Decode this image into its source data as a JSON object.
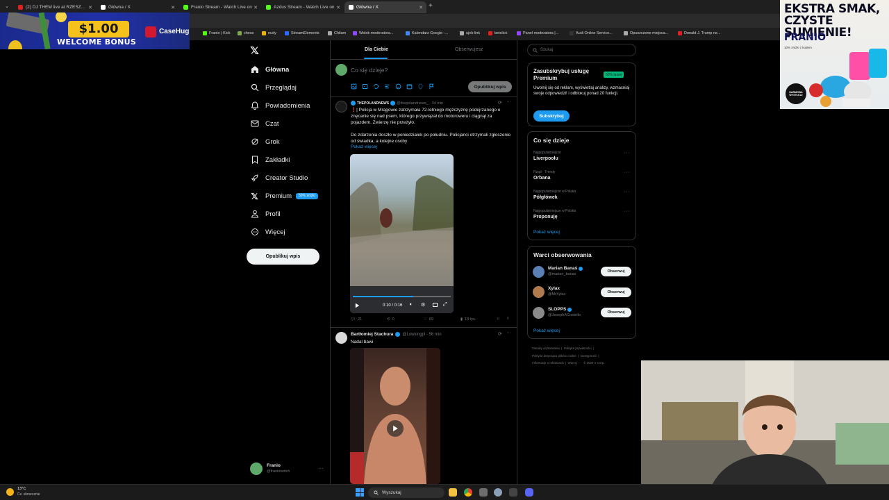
{
  "browser": {
    "tabs": [
      {
        "label": "(2) DJ THEM live at RZESZOW",
        "color": "#e02020",
        "active": false
      },
      {
        "label": "Główna / X",
        "color": "#ffffff",
        "active": false
      },
      {
        "label": "Franio Stream - Watch Live on",
        "color": "#53fc18",
        "active": false
      },
      {
        "label": "Azdus Stream - Watch Live on",
        "color": "#53fc18",
        "active": false
      },
      {
        "label": "Główna / X",
        "color": "#ffffff",
        "active": true
      }
    ],
    "bookmarks": [
      "Franio | Kick",
      "chess",
      "nudy",
      "StreamElements",
      "Chilam",
      "Widok moderatora...",
      "Kalendarz Google -...",
      "ujeb link",
      "betclick",
      "Panel moderatora |...",
      "Audi Online Service...",
      "Opuszczone miejsca...",
      "Donald J. Trump ne..."
    ]
  },
  "overlay_casino": {
    "price": "$1.00",
    "bonus": "WELCOME BONUS",
    "brand": "CaseHug"
  },
  "sidebar": {
    "items": [
      {
        "label": "Główna",
        "icon": "home-icon"
      },
      {
        "label": "Przeglądaj",
        "icon": "search-icon"
      },
      {
        "label": "Powiadomienia",
        "icon": "bell-icon"
      },
      {
        "label": "Czat",
        "icon": "mail-icon"
      },
      {
        "label": "Grok",
        "icon": "grok-icon"
      },
      {
        "label": "Zakładki",
        "icon": "bookmark-icon"
      },
      {
        "label": "Creator Studio",
        "icon": "rocket-icon"
      },
      {
        "label": "Premium",
        "icon": "x-icon"
      },
      {
        "label": "Profil",
        "icon": "person-icon"
      },
      {
        "label": "Więcej",
        "icon": "more-icon"
      }
    ],
    "premium_badge": "50% zniżki",
    "post_button": "Opublikuj wpis",
    "profile": {
      "name": "Franio",
      "handle": "@franiotwitch"
    }
  },
  "feed": {
    "tabs": [
      "Dla Ciebie",
      "Obserwujesz"
    ],
    "composer_placeholder": "Co się dzieje?",
    "composer_button": "Opublikuj wpis",
    "tweet1": {
      "author": "THEPOLANDNEWS",
      "handle": "@thepolandnews_ · 34 min",
      "text1": "❗️| Policja w Mrągowie zatrzymała 72-letniego mężczyznę podejrzanego o znęcanie się nad psem, którego przywiązał do motoroweru i ciągnął za pojazdem. Zwierzę nie przeżyło.",
      "text2": "Do zdarzenia doszło w poniedziałek po południu. Policjanci otrzymali zgłoszenie od świadka, a kolejne osoby",
      "show_more": "Pokaż więcej",
      "video_time": "0:10 / 0:16",
      "replies": "21",
      "reposts": "0",
      "likes": "69",
      "views": "13 tys.",
      "progress": 0.62
    },
    "tweet2": {
      "author": "Bartłomiej Stachura",
      "handle": "@Lowkingpl · 56 min",
      "text": "Nadal bawi"
    }
  },
  "right": {
    "search_placeholder": "Szukaj",
    "premium": {
      "title": "Zasubskrybuj usługę Premium",
      "badge": "50% taniej",
      "desc": "Uwolnij się od reklam, wyświetlaj analizy, wzmacniaj swoje odpowiedzi! i odbloкuj ponad 20 funkcji.",
      "button": "Subskrybuj"
    },
    "trends_title": "Co się dzieje",
    "trends": [
      {
        "category": "Najpopularniejsze",
        "name": "Liverpoolu"
      },
      {
        "category": "Rząd · Trendy",
        "name": "Orbana"
      },
      {
        "category": "Najpopularniejsze w Polska",
        "name": "Półgłówek"
      },
      {
        "category": "Najpopularniejsze w Polska",
        "name": "Proponuję"
      }
    ],
    "trends_more": "Pokaż więcej",
    "follow_title": "Warci obserwowania",
    "follows": [
      {
        "name": "Marian Banaś",
        "handle": "@marian_banas",
        "button": "Obserwuj",
        "avatar": "#5b7fb5"
      },
      {
        "name": "Xylax",
        "handle": "@MrXylax",
        "button": "Obserwuj",
        "avatar": "#b07a4f"
      },
      {
        "name": "SLOPPS",
        "handle": "@JosephACostello",
        "button": "Obserwuj",
        "avatar": "#8a8a8a"
      }
    ],
    "follow_more": "Pokaż więcej",
    "footer": [
      "Zasady użytkowania",
      "Polityka prywatności",
      "Polityka dotycząca plików cookie",
      "Dostępność",
      "Informacje o reklamach",
      "Więcej ···",
      "© 2026 X Corp."
    ]
  },
  "ad": {
    "headline": "EKSTRA SMAK, CZYSTE SUMIENIE!",
    "brand": "FRANIO",
    "sub": "10% zniżki z kodem",
    "stamp": "DARMOWA WYSYŁKA!"
  },
  "taskbar": {
    "weather_temp": "13°C",
    "weather_desc": "Cz. słonecznie",
    "search": "Wyszukaj"
  }
}
